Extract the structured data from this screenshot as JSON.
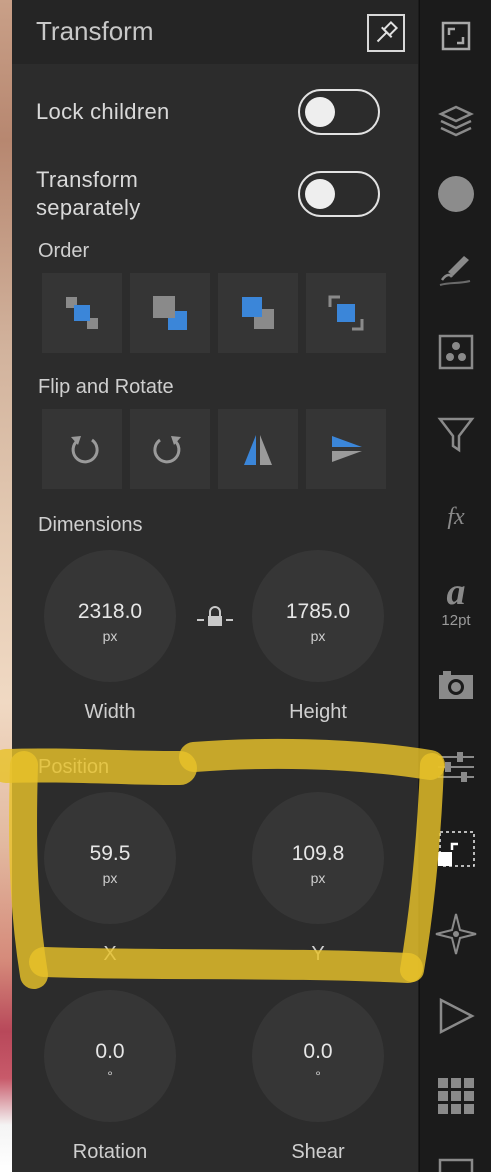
{
  "panel": {
    "title": "Transform",
    "lock_children": {
      "label": "Lock children",
      "on": false
    },
    "transform_separately": {
      "label_line1": "Transform",
      "label_line2": "separately",
      "on": false
    },
    "order": {
      "label": "Order",
      "items": [
        "bring-to-front-icon",
        "bring-forward-icon",
        "send-backward-icon",
        "send-to-back-icon"
      ]
    },
    "flip_rotate": {
      "label": "Flip and Rotate",
      "items": [
        "rotate-clockwise-icon",
        "rotate-counterclockwise-icon",
        "flip-horizontal-icon",
        "flip-vertical-icon"
      ]
    },
    "dimensions": {
      "label": "Dimensions",
      "width": {
        "value": "2318.0",
        "unit": "px",
        "label": "Width"
      },
      "height": {
        "value": "1785.0",
        "unit": "px",
        "label": "Height"
      }
    },
    "position": {
      "label": "Position",
      "x": {
        "value": "59.5",
        "unit": "px",
        "label": "X"
      },
      "y": {
        "value": "109.8",
        "unit": "px",
        "label": "Y"
      }
    },
    "rotation": {
      "value": "0.0",
      "unit": "°",
      "label": "Rotation"
    },
    "shear": {
      "value": "0.0",
      "unit": "°",
      "label": "Shear"
    }
  },
  "toolbar": {
    "font_size": "12pt",
    "icons": [
      "fullscreen-icon",
      "layers-icon",
      "color-icon",
      "brush-icon",
      "assets-icon",
      "filter-icon",
      "fx-icon",
      "text-style-icon",
      "camera-icon",
      "adjustments-icon",
      "transform-icon",
      "navigator-icon",
      "play-icon",
      "grid-icon"
    ]
  },
  "colors": {
    "accent": "#3b86d9",
    "highlight": "#e8c229",
    "panel": "#2c2c2c"
  }
}
